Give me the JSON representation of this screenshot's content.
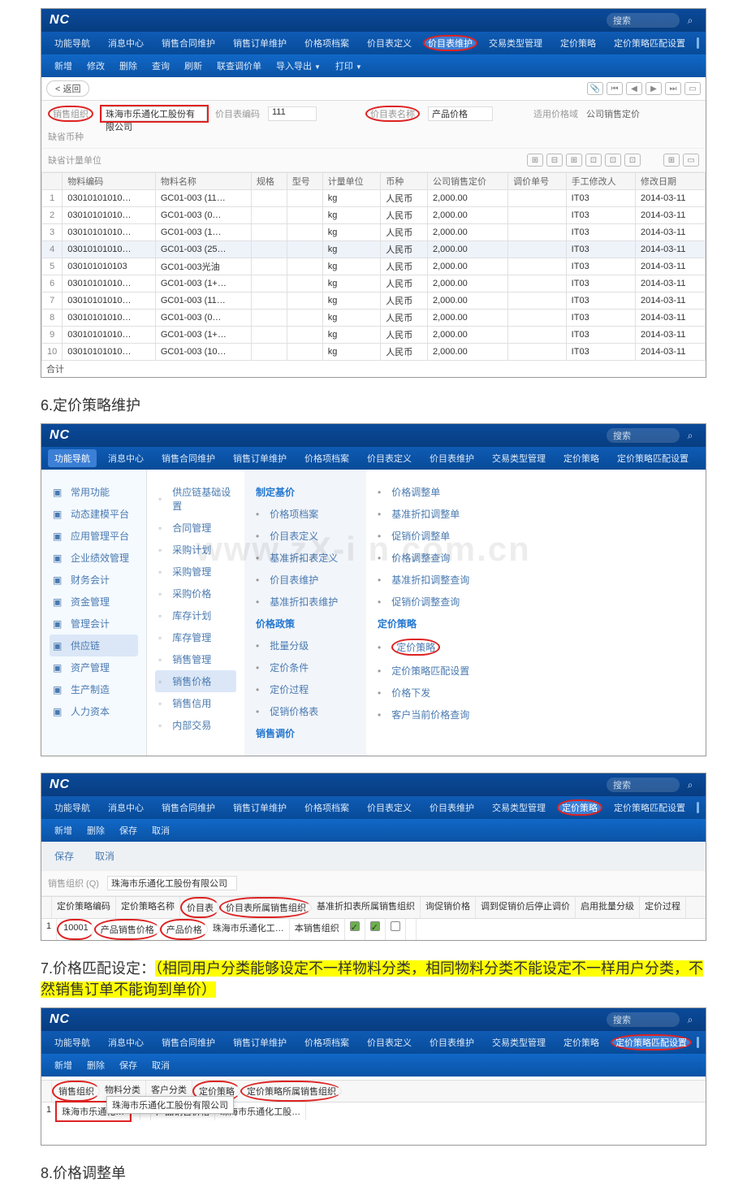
{
  "doc": {
    "h6": "6.定价策略维护",
    "h7_prefix": "7.价格匹配设定：",
    "h7_hl": "（相同用户分类能够设定不一样物料分类，相同物料分类不能设定不一样用户分类，不然销售订单不能询到单价）",
    "h8": "8.价格调整单"
  },
  "s1": {
    "search_placeholder": "搜索",
    "tabs": [
      "功能导航",
      "消息中心",
      "销售合同维护",
      "销售订单维护",
      "价格项档案",
      "价目表定义",
      "价目表维护",
      "交易类型管理",
      "定价策略",
      "定价策略匹配设置"
    ],
    "active_tab": "价目表维护",
    "toolbar": [
      "新增",
      "修改",
      "删除",
      "查询",
      "刷新",
      "联查调价单",
      "导入导出",
      "打印"
    ],
    "back": "< 返回",
    "form": {
      "sale_org_label": "销售组织",
      "sale_org_value": "珠海市乐通化工股份有限公司",
      "list_code_label": "价目表编码",
      "list_code_value": "111",
      "list_name_label": "价目表名称",
      "list_name_value": "产品价格",
      "range_label": "适用价格域",
      "range_value": "公司销售定价",
      "curr_label": "缺省币种",
      "uom_label": "缺省计量单位"
    },
    "columns": [
      "",
      "物料编码",
      "物料名称",
      "规格",
      "型号",
      "计量单位",
      "币种",
      "公司销售定价",
      "调价单号",
      "手工修改人",
      "修改日期"
    ],
    "rows": [
      [
        "1",
        "03010101010…",
        "GC01-003 (11…",
        "",
        "",
        "kg",
        "人民币",
        "2,000.00",
        "",
        "IT03",
        "2014-03-11"
      ],
      [
        "2",
        "03010101010…",
        "GC01-003 (0…",
        "",
        "",
        "kg",
        "人民币",
        "2,000.00",
        "",
        "IT03",
        "2014-03-11"
      ],
      [
        "3",
        "03010101010…",
        "GC01-003 (1…",
        "",
        "",
        "kg",
        "人民币",
        "2,000.00",
        "",
        "IT03",
        "2014-03-11"
      ],
      [
        "4",
        "03010101010…",
        "GC01-003 (25…",
        "",
        "",
        "kg",
        "人民币",
        "2,000.00",
        "",
        "IT03",
        "2014-03-11"
      ],
      [
        "5",
        "030101010103",
        "GC01-003光油",
        "",
        "",
        "kg",
        "人民币",
        "2,000.00",
        "",
        "IT03",
        "2014-03-11"
      ],
      [
        "6",
        "03010101010…",
        "GC01-003 (1+…",
        "",
        "",
        "kg",
        "人民币",
        "2,000.00",
        "",
        "IT03",
        "2014-03-11"
      ],
      [
        "7",
        "03010101010…",
        "GC01-003 (11…",
        "",
        "",
        "kg",
        "人民币",
        "2,000.00",
        "",
        "IT03",
        "2014-03-11"
      ],
      [
        "8",
        "03010101010…",
        "GC01-003 (0…",
        "",
        "",
        "kg",
        "人民币",
        "2,000.00",
        "",
        "IT03",
        "2014-03-11"
      ],
      [
        "9",
        "03010101010…",
        "GC01-003 (1+…",
        "",
        "",
        "kg",
        "人民币",
        "2,000.00",
        "",
        "IT03",
        "2014-03-11"
      ],
      [
        "10",
        "03010101010…",
        "GC01-003 (10…",
        "",
        "",
        "kg",
        "人民币",
        "2,000.00",
        "",
        "IT03",
        "2014-03-11"
      ]
    ],
    "sum_label": "合计"
  },
  "s2": {
    "tabs": [
      "功能导航",
      "消息中心",
      "销售合同维护",
      "销售订单维护",
      "价格项档案",
      "价目表定义",
      "价目表维护",
      "交易类型管理",
      "定价策略",
      "定价策略匹配设置"
    ],
    "search_placeholder": "搜索",
    "col1": [
      {
        "t": "常用功能"
      },
      {
        "t": "动态建模平台"
      },
      {
        "t": "应用管理平台"
      },
      {
        "t": "企业绩效管理"
      },
      {
        "t": "财务会计"
      },
      {
        "t": "资金管理"
      },
      {
        "t": "管理会计"
      },
      {
        "t": "供应链",
        "active": true
      },
      {
        "t": "资产管理"
      },
      {
        "t": "生产制造"
      },
      {
        "t": "人力资本"
      }
    ],
    "col2": [
      "供应链基础设置",
      "合同管理",
      "采购计划",
      "采购管理",
      "采购价格",
      "库存计划",
      "库存管理",
      "销售管理",
      "销售价格",
      "销售信用",
      "内部交易"
    ],
    "col2_active": "销售价格",
    "col3_h1": "制定基价",
    "col3_g1": [
      "价格项档案",
      "价目表定义",
      "基准折扣表定义",
      "价目表维护",
      "基准折扣表维护"
    ],
    "col3_h2": "价格政策",
    "col3_g2": [
      "批量分级",
      "定价条件",
      "定价过程",
      "促销价格表"
    ],
    "col3_h3": "销售调价",
    "col4_h1": "定价策略",
    "col4_item_circled": "定价策略",
    "col4_g1": [
      "价格调整单",
      "基准折扣调整单",
      "促销价调整单",
      "价格调整查询",
      "基准折扣调整查询",
      "促销价调整查询"
    ],
    "col4_g2": [
      "定价策略匹配设置"
    ],
    "col4_g3": [
      "价格下发",
      "客户当前价格查询"
    ],
    "watermark": "www.zX-i n.com.cn"
  },
  "s3": {
    "tabs": [
      "功能导航",
      "消息中心",
      "销售合同维护",
      "销售订单维护",
      "价格项档案",
      "价目表定义",
      "价目表维护",
      "交易类型管理",
      "定价策略",
      "定价策略匹配设置"
    ],
    "active_tab": "定价策略",
    "toolbar": [
      "新增",
      "删除",
      "保存",
      "取消"
    ],
    "toolbar2": [
      "保存",
      "取消"
    ],
    "search_placeholder": "搜索",
    "org_label": "销售组织 (Q)",
    "org_value": "珠海市乐通化工股份有限公司",
    "cols": [
      "",
      "定价策略编码",
      "定价策略名称",
      "价目表",
      "价目表所属销售组织",
      "基准折扣表所属销售组织",
      "询促销价格",
      "调到促销价后停止调价",
      "启用批量分级",
      "定价过程"
    ],
    "row": [
      "1",
      "10001",
      "产品销售价格",
      "产品价格",
      "珠海市乐通化工…",
      "本销售组织",
      "☑",
      "☑",
      "☐",
      ""
    ]
  },
  "s4": {
    "tabs": [
      "功能导航",
      "消息中心",
      "销售合同维护",
      "销售订单维护",
      "价格项档案",
      "价目表定义",
      "价目表维护",
      "交易类型管理",
      "定价策略",
      "定价策略匹配设置"
    ],
    "active_tab": "定价策略匹配设置",
    "toolbar": [
      "新增",
      "删除",
      "保存",
      "取消"
    ],
    "search_placeholder": "搜索",
    "cols": [
      "",
      "销售组织",
      "物料分类",
      "客户分类",
      "定价策略",
      "定价策略所属销售组织"
    ],
    "row": [
      "1",
      "珠海市乐通化…",
      "",
      "",
      "产品销售价格",
      "珠海市乐通化工股…"
    ],
    "dropdown": "珠海市乐通化工股份有限公司"
  }
}
